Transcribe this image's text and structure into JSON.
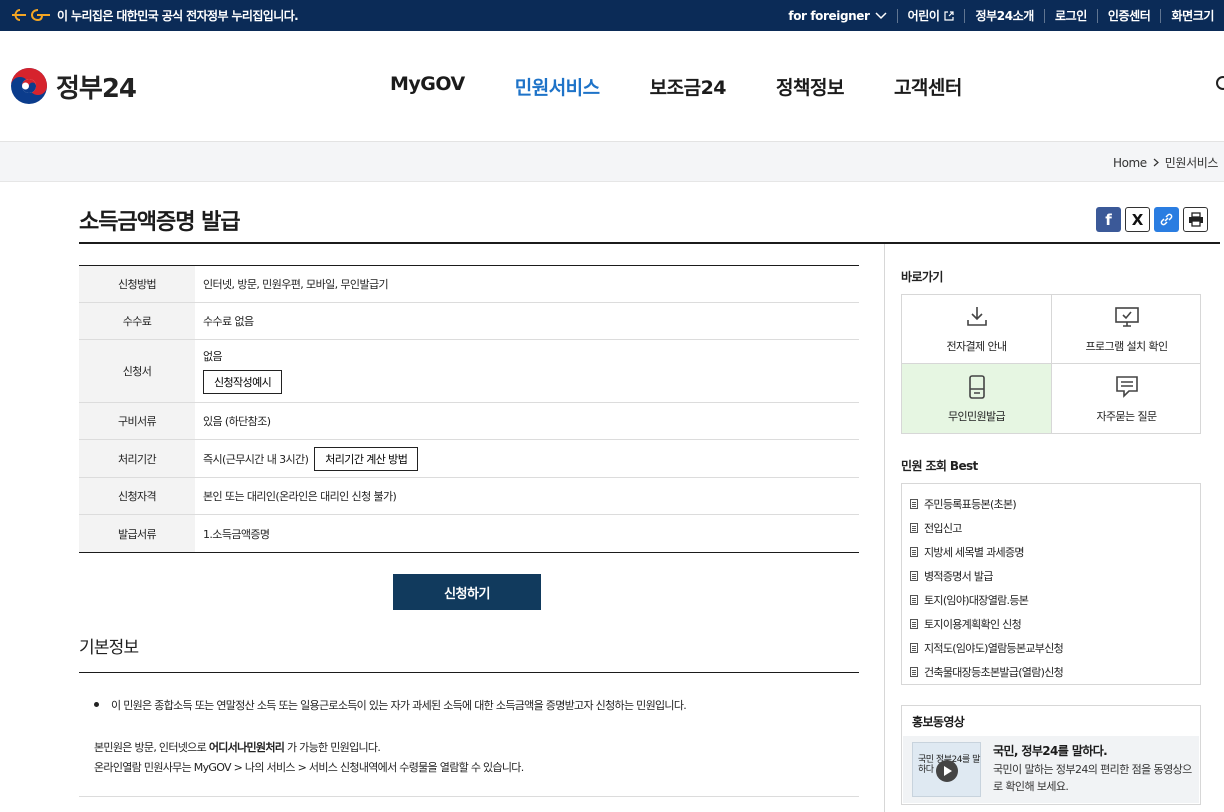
{
  "banner": {
    "official_text": "이 누리집은 대한민국 공식 전자정부 누리집입니다."
  },
  "util_links": [
    {
      "label": "for foreigner",
      "icon": "chevron-down-icon"
    },
    {
      "label": "어린이",
      "icon": "external-link-icon"
    },
    {
      "label": "정부24소개"
    },
    {
      "label": "로그인"
    },
    {
      "label": "인증센터"
    },
    {
      "label": "화면크기"
    }
  ],
  "logo": {
    "text": "정부24"
  },
  "nav": {
    "items": [
      "MyGOV",
      "민원서비스",
      "보조금24",
      "정책정보",
      "고객센터"
    ],
    "active": "민원서비스"
  },
  "breadcrumb": {
    "home": "Home",
    "current": "민원서비스"
  },
  "page": {
    "title": "소득금액증명 발급"
  },
  "share": {
    "facebook": "f",
    "x": "X"
  },
  "info": {
    "rows": [
      {
        "label": "신청방법",
        "value": "인터넷, 방문, 민원우편, 모바일, 무인발급기"
      },
      {
        "label": "수수료",
        "value": "수수료 없음"
      },
      {
        "label": "신청서",
        "value": "없음",
        "button": "신청작성예시"
      },
      {
        "label": "구비서류",
        "value": "있음 (하단참조)"
      },
      {
        "label": "처리기간",
        "value": "즉시(근무시간 내 3시간)",
        "button": "처리기간 계산 방법"
      },
      {
        "label": "신청자격",
        "value": "본인 또는 대리인(온라인은 대리인 신청 불가)"
      },
      {
        "label": "발급서류",
        "value": "1.소득금액증명"
      }
    ]
  },
  "apply_button": "신청하기",
  "basic_info": {
    "title": "기본정보",
    "bullet": "이 민원은 종합소득 또는 연말정산 소득 또는 일용근로소득이 있는 자가 과세된 소득에 대한 소득금액을 증명받고자 신청하는 민원입니다.",
    "line1_pre": "본민원은 방문, 인터넷으로 ",
    "line1_bold": "어디서나민원처리",
    "line1_post": " 가 가능한 민원입니다.",
    "line2": "온라인열람 민원사무는 MyGOV > 나의 서비스 > 서비스 신청내역에서 수령물을 열람할 수 있습니다."
  },
  "sidebar": {
    "quick_title": "바로가기",
    "quick": [
      {
        "label": "전자결제 안내",
        "icon": "download-icon"
      },
      {
        "label": "프로그램 설치 확인",
        "icon": "monitor-check-icon"
      },
      {
        "label": "무인민원발급",
        "icon": "kiosk-icon",
        "highlight": true
      },
      {
        "label": "자주묻는 질문",
        "icon": "chat-icon"
      }
    ],
    "best_title": "민원 조회 Best",
    "best": [
      "주민등록표등본(초본)",
      "전입신고",
      "지방세 세목별 과세증명",
      "병적증명서 발급",
      "토지(임야)대장열람.등본",
      "토지이용계획확인 신청",
      "지적도(임야도)열람등본교부신청",
      "건축물대장등초본발급(열람)신청"
    ],
    "promo_title": "홍보동영상",
    "promo_headline": "국민, 정부24를 말하다.",
    "promo_desc": "국민이 말하는 정부24의 편리한 점을 동영상으로 확인해 보세요.",
    "promo_thumb_text": "국민 정부24를 말하다"
  },
  "colors": {
    "banner": "#0b2b57",
    "nav_active": "#1e73c8",
    "apply": "#113a5d",
    "highlight": "#e6f6e2"
  }
}
